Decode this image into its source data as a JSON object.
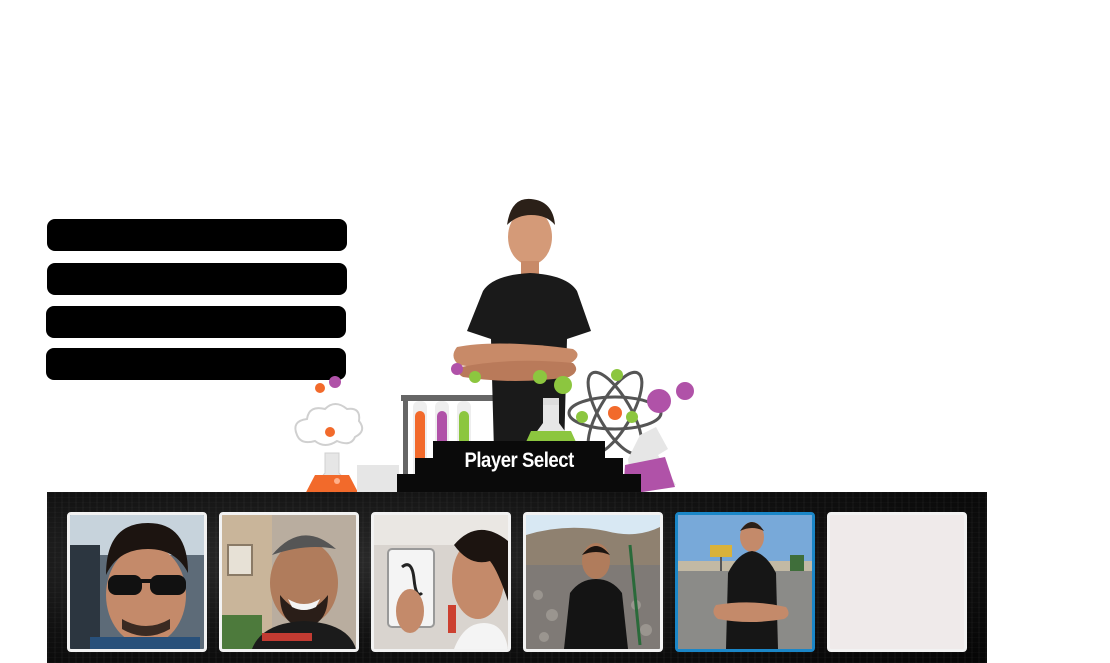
{
  "menu": {
    "buttons": [
      {
        "label": ""
      },
      {
        "label": ""
      },
      {
        "label": ""
      },
      {
        "label": ""
      }
    ]
  },
  "title": "Player Select",
  "selected_index": 4,
  "roster": [
    {
      "portrait": "man-in-sunglasses-car-selfie"
    },
    {
      "portrait": "laughing-man-mohawk-outdoors"
    },
    {
      "portrait": "man-holding-tablet-drawing"
    },
    {
      "portrait": "man-in-wetsuit-on-rocky-beach"
    },
    {
      "portrait": "man-black-tshirt-arms-crossed-parking-lot"
    },
    {
      "portrait": "empty"
    }
  ],
  "colors": {
    "selected_border": "#1a86c7",
    "slot_border": "#f2f2f2",
    "flask_orange": "#f26a2b",
    "flask_purple": "#b052a8",
    "flask_green": "#8cc63f"
  }
}
